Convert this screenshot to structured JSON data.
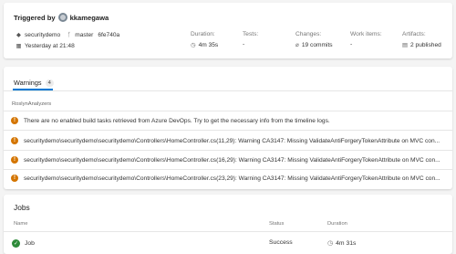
{
  "summary": {
    "triggered_by_label": "Triggered by",
    "user_name": "kkamegawa",
    "repository": "securitydemo",
    "branch": "master",
    "commit": "6fe740a",
    "timestamp": "Yesterday at 21:48",
    "duration": {
      "label": "Duration:",
      "value": "4m 35s"
    },
    "tests": {
      "label": "Tests:",
      "value": "-"
    },
    "changes": {
      "label": "Changes:",
      "value": "19 commits"
    },
    "work_items": {
      "label": "Work items:",
      "value": "-"
    },
    "artifacts": {
      "label": "Artifacts:",
      "value": "2 published"
    }
  },
  "warnings": {
    "tab_label": "Warnings",
    "count": "4",
    "group_label": "RoslynAnalyzers",
    "items": [
      "There are no enabled build tasks retrieved from Azure DevOps. Try to get the necessary info from the timeline logs.",
      "securitydemo\\securitydemo\\securitydemo\\Controllers\\HomeController.cs(11,29): Warning CA3147: Missing ValidateAntiForgeryTokenAttribute on MVC con...",
      "securitydemo\\securitydemo\\securitydemo\\Controllers\\HomeController.cs(16,29): Warning CA3147: Missing ValidateAntiForgeryTokenAttribute on MVC con...",
      "securitydemo\\securitydemo\\securitydemo\\Controllers\\HomeController.cs(23,29): Warning CA3147: Missing ValidateAntiForgeryTokenAttribute on MVC con..."
    ]
  },
  "jobs": {
    "title": "Jobs",
    "headers": {
      "name": "Name",
      "status": "Status",
      "duration": "Duration"
    },
    "rows": [
      {
        "name": "Job",
        "status": "Success",
        "duration": "4m 31s"
      }
    ]
  },
  "colors": {
    "accent": "#0078d4",
    "warning": "#d47500",
    "success": "#2e8b3a"
  }
}
